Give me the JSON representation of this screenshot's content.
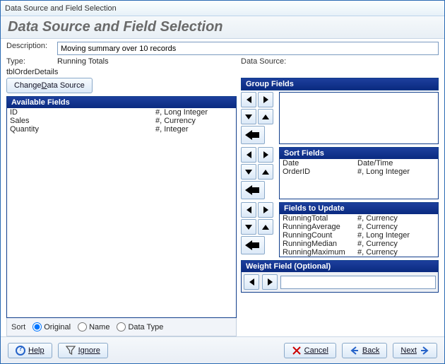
{
  "window": {
    "title": "Data Source and Field Selection"
  },
  "header": {
    "title": "Data Source and Field Selection"
  },
  "info": {
    "description_label": "Description:",
    "description_value": "Moving summary over 10 records",
    "type_label": "Type:",
    "type_value": "Running Totals",
    "datasource_label": "Data Source:",
    "datasource_value": "tblOrderDetails"
  },
  "buttons": {
    "change_ds_pre": "Change ",
    "change_ds_ul": "D",
    "change_ds_post": "ata Source",
    "help": "Help",
    "ignore": "Ignore",
    "cancel": "Cancel",
    "back": "Back",
    "next": "Next"
  },
  "available": {
    "title": "Available Fields",
    "fields": [
      {
        "name": "ID",
        "type": "#, Long Integer"
      },
      {
        "name": "Sales",
        "type": "#, Currency"
      },
      {
        "name": "Quantity",
        "type": "#, Integer"
      }
    ],
    "sort_label": "Sort",
    "sort_options": {
      "original": "Original",
      "name": "Name",
      "datatype": "Data Type"
    },
    "sort_selected": "original"
  },
  "group_fields": {
    "title": "Group Fields",
    "items": []
  },
  "sort_fields": {
    "title": "Sort Fields",
    "items": [
      {
        "name": "Date",
        "type": "Date/Time"
      },
      {
        "name": "OrderID",
        "type": "#, Long Integer"
      }
    ]
  },
  "update_fields": {
    "title": "Fields to Update",
    "items": [
      {
        "name": "RunningTotal",
        "type": "#, Currency"
      },
      {
        "name": "RunningAverage",
        "type": "#, Currency"
      },
      {
        "name": "RunningCount",
        "type": "#, Long Integer"
      },
      {
        "name": "RunningMedian",
        "type": "#, Currency"
      },
      {
        "name": "RunningMaximum",
        "type": "#, Currency"
      }
    ]
  },
  "weight": {
    "title": "Weight Field (Optional)",
    "value": ""
  }
}
